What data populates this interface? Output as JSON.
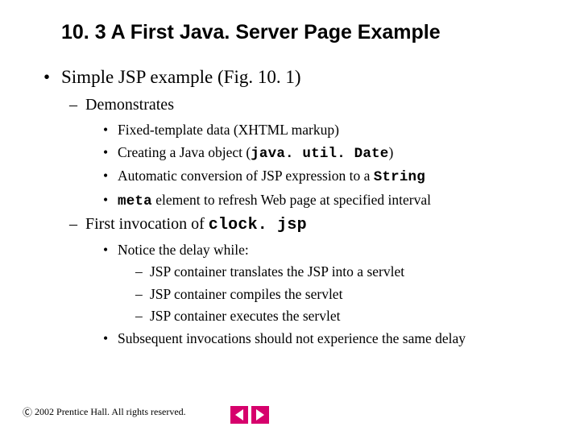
{
  "title": "10. 3   A First Java. Server Page Example",
  "bullets": {
    "l1_a": "Simple JSP example (Fig. 10. 1)",
    "l2_a": "Demonstrates",
    "l3_a": "Fixed-template data (XHTML markup)",
    "l3_b_pre": "Creating a Java object (",
    "l3_b_code": "java. util. Date",
    "l3_b_post": ")",
    "l3_c_pre": "Automatic conversion of JSP expression to a ",
    "l3_c_code": "String",
    "l3_d_code": "meta",
    "l3_d_post": " element to refresh Web page at specified interval",
    "l2_b_pre": "First invocation of ",
    "l2_b_code": "clock. jsp",
    "l3_e": "Notice the delay while:",
    "l4_a": "JSP container translates the JSP into a servlet",
    "l4_b": "JSP container compiles the servlet",
    "l4_c": "JSP container executes the servlet",
    "l3_f": "Subsequent invocations should not experience the same delay"
  },
  "footer": {
    "text": "2002 Prentice Hall. All rights reserved."
  },
  "nav": {
    "prev": "previous-slide",
    "next": "next-slide"
  }
}
